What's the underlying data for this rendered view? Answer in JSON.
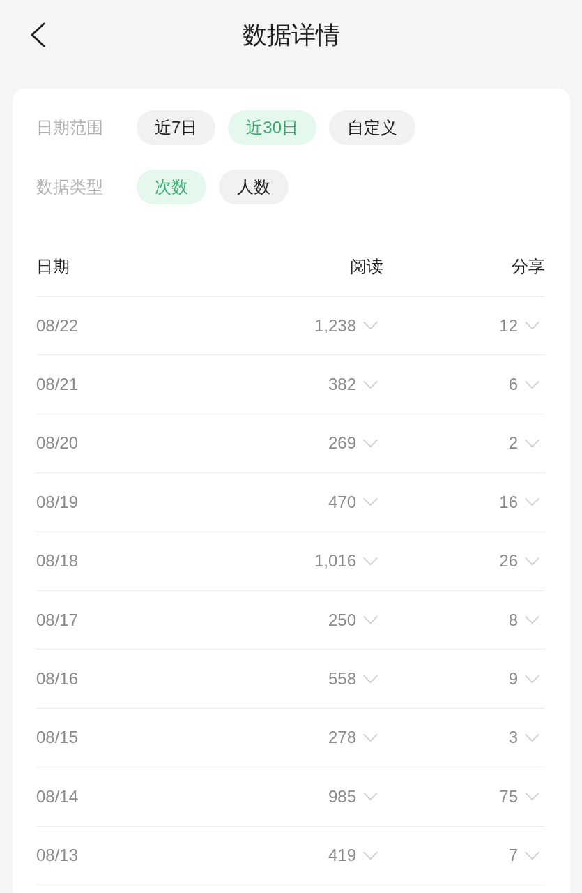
{
  "header": {
    "title": "数据详情"
  },
  "filters": [
    {
      "label": "日期范围",
      "options": [
        {
          "label": "近7日",
          "selected": false
        },
        {
          "label": "近30日",
          "selected": true
        },
        {
          "label": "自定义",
          "selected": false
        }
      ]
    },
    {
      "label": "数据类型",
      "options": [
        {
          "label": "次数",
          "selected": true
        },
        {
          "label": "人数",
          "selected": false
        }
      ]
    }
  ],
  "table": {
    "columns": [
      "日期",
      "阅读",
      "分享"
    ],
    "rows": [
      [
        "08/22",
        "1,238",
        "12"
      ],
      [
        "08/21",
        "382",
        "6"
      ],
      [
        "08/20",
        "269",
        "2"
      ],
      [
        "08/19",
        "470",
        "16"
      ],
      [
        "08/18",
        "1,016",
        "26"
      ],
      [
        "08/17",
        "250",
        "8"
      ],
      [
        "08/16",
        "558",
        "9"
      ],
      [
        "08/15",
        "278",
        "3"
      ],
      [
        "08/14",
        "985",
        "75"
      ],
      [
        "08/13",
        "419",
        "7"
      ]
    ]
  }
}
